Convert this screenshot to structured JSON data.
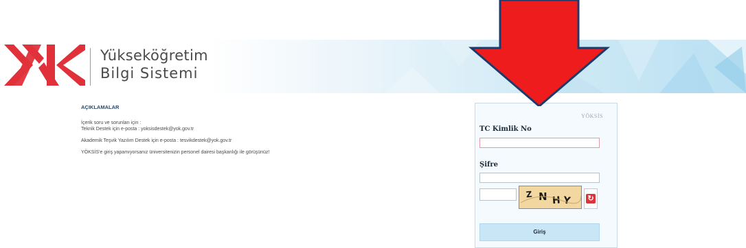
{
  "header": {
    "brand_line1": "Yükseköğretim",
    "brand_line2": "Bilgi Sistemi",
    "logo_icon": "yok-logo-icon",
    "logo_color": "#e0313a"
  },
  "info": {
    "title": "AÇIKLAMALAR",
    "line1": "İçerik soru ve sorunları için :",
    "line2": "Teknik Destek için e-posta : yoksisdestek@yok.gov.tr",
    "line3": "Akademik Teşvik Yazılım Destek için e-posta : tesvikdestek@yok.gov.tr",
    "line4": "YÖKSİS'e giriş yapamıyorsanız üniversitenizin personel dairesi başkanlığı ile görüşünüz!"
  },
  "login": {
    "system_label": "YÖKSİS",
    "tc_label": "TC Kimlik No",
    "tc_value": "",
    "password_label": "Şifre",
    "password_value": "",
    "captcha_value": "",
    "captcha_text": "ZNHY",
    "refresh_icon": "refresh-icon",
    "submit_label": "Giriş"
  },
  "annotation": {
    "arrow_icon": "down-arrow-icon",
    "arrow_color": "#ee1c1c"
  }
}
